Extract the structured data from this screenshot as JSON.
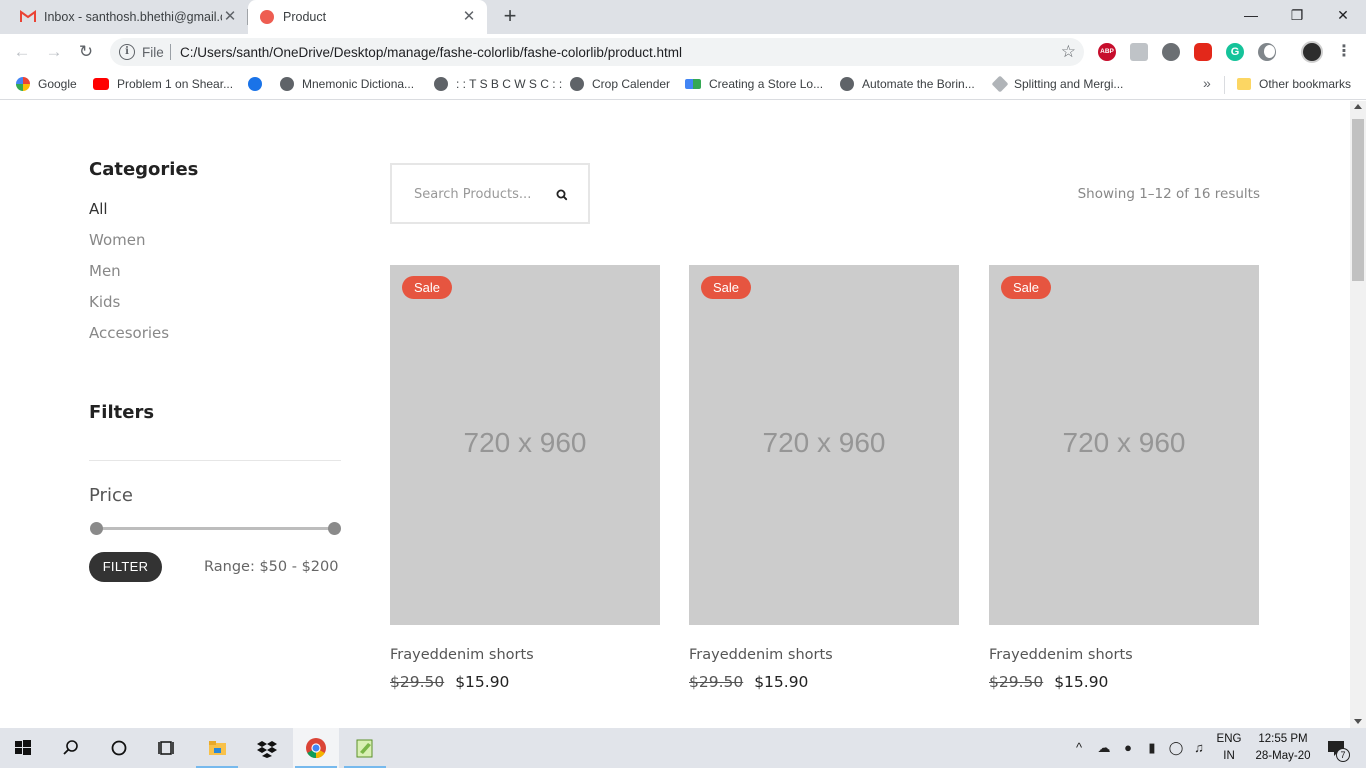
{
  "browser": {
    "tabs": [
      {
        "title": "Inbox - santhosh.bhethi@gmail.c",
        "icon": "gmail-icon",
        "active": false
      },
      {
        "title": "Product",
        "icon": "page-favicon",
        "active": true
      }
    ],
    "address": {
      "scheme": "File",
      "url": "C:/Users/santh/OneDrive/Desktop/manage/fashe-colorlib/fashe-colorlib/product.html"
    },
    "extensions": [
      "abp-icon",
      "cube-icon",
      "people-icon",
      "stop-icon",
      "grammarly-icon",
      "dark-mode-icon"
    ],
    "abp_label": "ABP",
    "grammarly_label": "G",
    "bookmarks": [
      {
        "label": "Google",
        "icon": "google-icon"
      },
      {
        "label": "Problem 1 on Shear...",
        "icon": "youtube-icon"
      },
      {
        "label": "",
        "icon": "gear-icon"
      },
      {
        "label": "Mnemonic Dictiona...",
        "icon": "globe-icon"
      },
      {
        "label": ": : T S B C W S C : :",
        "icon": "globe-icon"
      },
      {
        "label": "Crop Calender",
        "icon": "globe-icon"
      },
      {
        "label": "Creating a Store Lo...",
        "icon": "code-icon"
      },
      {
        "label": "Automate the Borin...",
        "icon": "globe-icon"
      },
      {
        "label": "Splitting and Mergi...",
        "icon": "pen-icon"
      }
    ],
    "bookmarks_more": "»",
    "other_bookmarks": "Other bookmarks"
  },
  "sidebar": {
    "categories_title": "Categories",
    "categories": [
      {
        "label": "All",
        "active": true
      },
      {
        "label": "Women",
        "active": false
      },
      {
        "label": "Men",
        "active": false
      },
      {
        "label": "Kids",
        "active": false
      },
      {
        "label": "Accesories",
        "active": false
      }
    ],
    "filters_title": "Filters",
    "price_label": "Price",
    "filter_button": "FILTER",
    "range_text": "Range: $50 - $200",
    "price_slider": {
      "min": 50,
      "max": 200
    }
  },
  "main": {
    "search_placeholder": "Search Products...",
    "result_count": "Showing 1–12 of 16 results",
    "products": [
      {
        "badge": "Sale",
        "image_text": "720 x 960",
        "name": "Frayeddenim shorts",
        "old_price": "$29.50",
        "new_price": "$15.90"
      },
      {
        "badge": "Sale",
        "image_text": "720 x 960",
        "name": "Frayeddenim shorts",
        "old_price": "$29.50",
        "new_price": "$15.90"
      },
      {
        "badge": "Sale",
        "image_text": "720 x 960",
        "name": "Frayeddenim shorts",
        "old_price": "$29.50",
        "new_price": "$15.90"
      }
    ]
  },
  "taskbar": {
    "apps": [
      "windows-start-icon",
      "search-icon",
      "cortana-icon",
      "task-view-icon",
      "file-explorer-icon",
      "dropbox-icon",
      "chrome-icon",
      "notepad-plus-icon"
    ],
    "language": "ENG",
    "region": "IN",
    "time": "12:55 PM",
    "date": "28-May-20",
    "notification_count": "7"
  },
  "colors": {
    "sale_badge": "#e65540",
    "filter_button": "#333333",
    "image_placeholder": "#cccccc"
  }
}
